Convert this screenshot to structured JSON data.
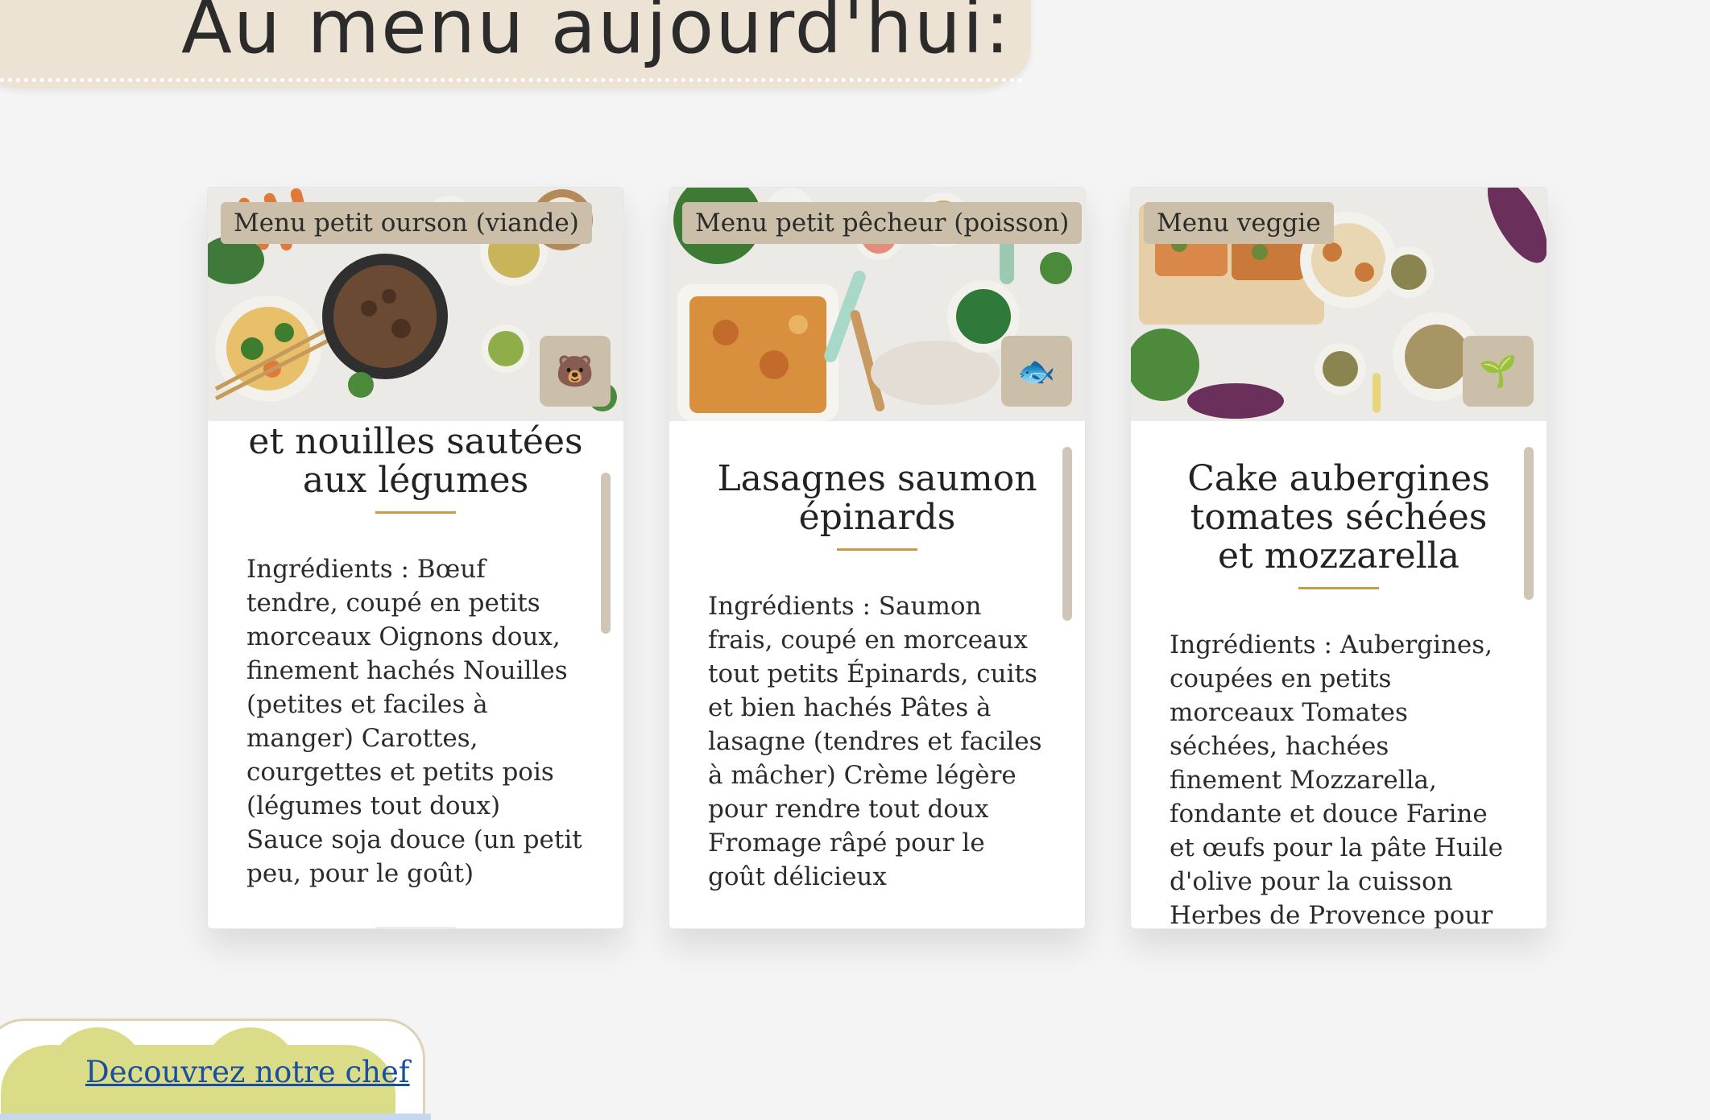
{
  "header": {
    "title": "Au menu aujourd'hui:"
  },
  "cards": [
    {
      "tag": "Menu petit ourson (viande)",
      "icon": "bear-icon",
      "icon_glyph": "🐻",
      "title": "et nouilles sautées aux légumes",
      "ingredients": "Ingrédients : Bœuf tendre, coupé en petits morceaux Oignons doux, finement hachés Nouilles (petites et faciles à manger) Carottes, courgettes et petits pois (légumes tout doux) Sauce soja douce (un petit peu, pour le goût)"
    },
    {
      "tag": "Menu petit pêcheur (poisson)",
      "icon": "fish-icon",
      "icon_glyph": "🐟",
      "title": "Lasagnes saumon épinards",
      "ingredients": "Ingrédients : Saumon frais, coupé en morceaux tout petits Épinards, cuits et bien hachés Pâtes à lasagne (tendres et faciles à mâcher) Crème légère pour rendre tout doux Fromage râpé pour le goût délicieux"
    },
    {
      "tag": "Menu veggie",
      "icon": "seedling-icon",
      "icon_glyph": "🌱",
      "title": "Cake aubergines tomates séchées et mozzarella",
      "ingredients": "Ingrédients : Aubergines, coupées en petits morceaux Tomates séchées, hachées finement Mozzarella, fondante et douce Farine et œufs pour la pâte Huile d'olive pour la cuisson Herbes de Provence pour une"
    }
  ],
  "chef": {
    "link_label": "Decouvrez notre chef"
  },
  "colors": {
    "banner": "#ede3d5",
    "tag": "#cbbfa9",
    "accent_underline": "#c99a4a",
    "chef_button": "#dbdc87",
    "link": "#1a4fa0"
  }
}
